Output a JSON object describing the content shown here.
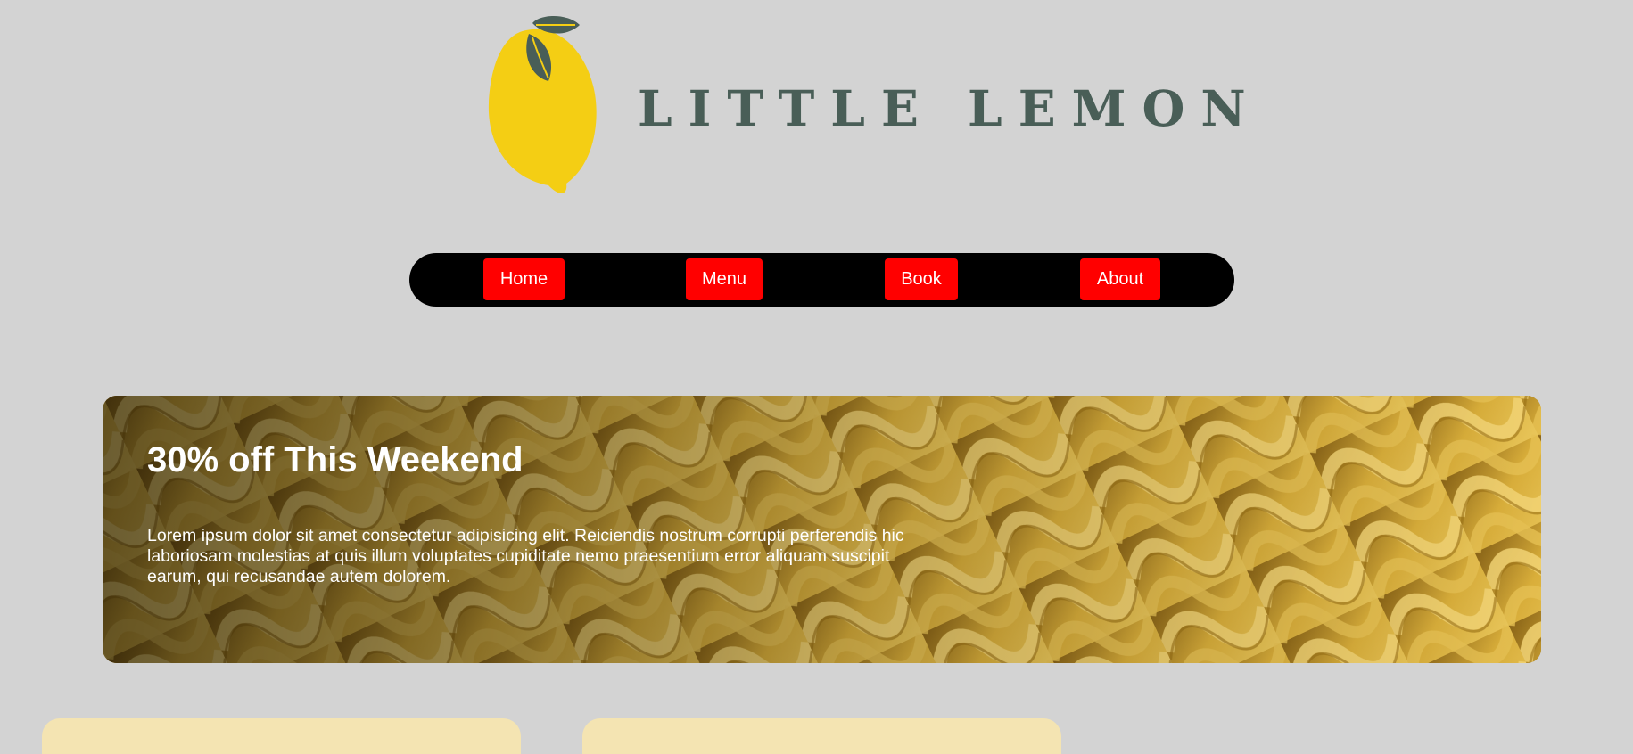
{
  "header": {
    "brand": "LITTLE LEMON",
    "logo_icon": "lemon-icon"
  },
  "nav": {
    "items": [
      {
        "label": "Home"
      },
      {
        "label": "Menu"
      },
      {
        "label": "Book"
      },
      {
        "label": "About"
      }
    ]
  },
  "hero": {
    "title": "30% off This Weekend",
    "text": "Lorem ipsum dolor sit amet consectetur adipisicing elit. Reiciendis nostrum corrupti perferendis hic laboriosam molestias at quis illum voluptates cupiditate nemo praesentium error aliquam suscipit earum, qui recusandae autem dolorem.",
    "background": "pasta-image"
  },
  "colors": {
    "page_background": "#d3d3d3",
    "brand_green": "#495e57",
    "lemon_yellow": "#f4ce14",
    "nav_background": "#000000",
    "nav_button": "#ff0000",
    "card_background": "#f4e4b2"
  }
}
